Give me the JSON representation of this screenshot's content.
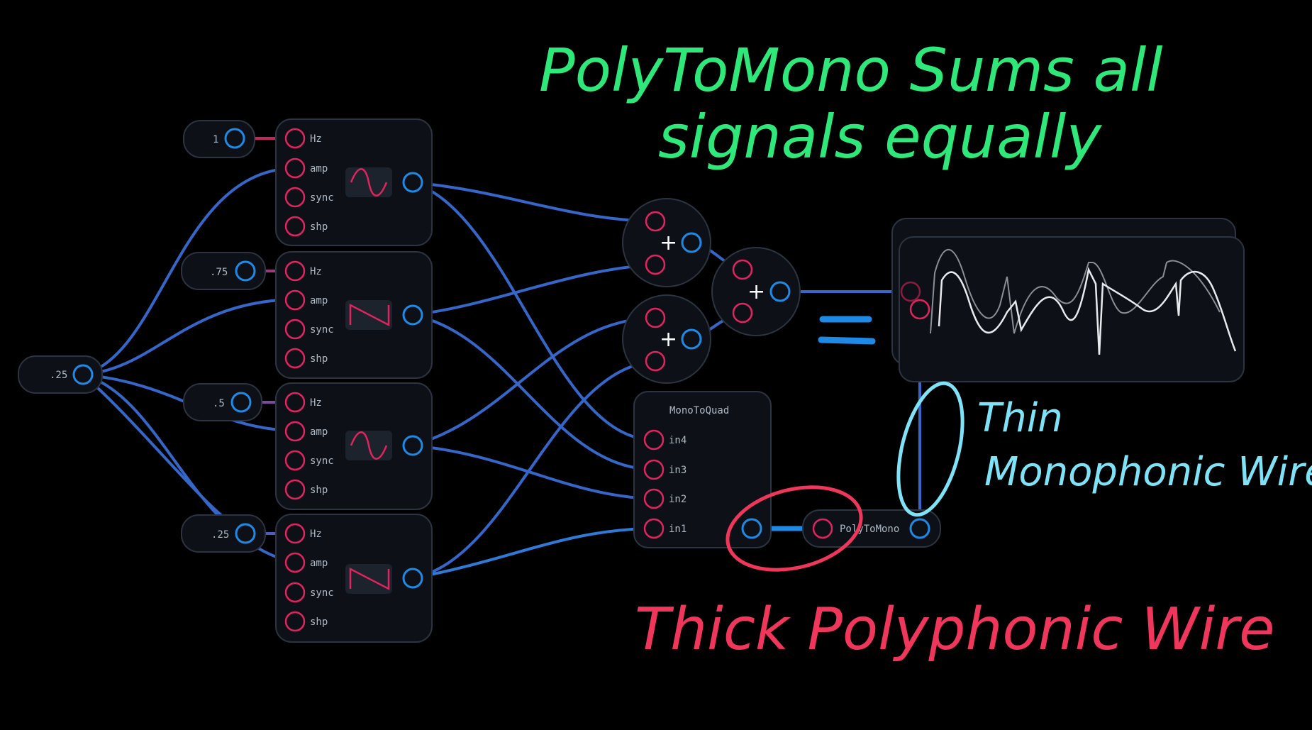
{
  "annotations": {
    "title_line1": "PolyToMono Sums all",
    "title_line2": "signals equally",
    "thin_line1": "Thin",
    "thin_line2": "Monophonic Wire",
    "thick": "Thick Polyphonic Wire",
    "colors": {
      "green": "#2ee87a",
      "cyan": "#7fe3f7",
      "red": "#f0365a"
    }
  },
  "nodes": {
    "master_const": ".25",
    "osc_hz_consts": [
      "1",
      ".75",
      ".5",
      ".25"
    ],
    "osc_inputs": [
      "Hz",
      "amp",
      "sync",
      "shp"
    ],
    "osc_shapes": [
      "sine",
      "saw",
      "sine",
      "saw"
    ],
    "mono_to_quad": {
      "title": "MonoToQuad",
      "inputs": [
        "in4",
        "in3",
        "in2",
        "in1"
      ]
    },
    "poly_to_mono": "PolyToMono",
    "adder_symbol": "+"
  },
  "colors": {
    "node_bg": "#0d1117",
    "node_border": "#2b3440",
    "inlet": "#e0245e",
    "outlet": "#1f8ae6",
    "wire": "#3566c8",
    "text": "#aeb8c4"
  }
}
